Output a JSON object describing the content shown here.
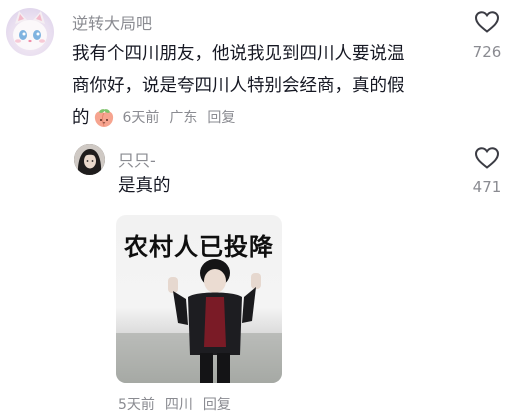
{
  "comment": {
    "username": "逆转大局吧",
    "lines": [
      "我有个四川朋友，他说我见到四川人要说温",
      "商你好，说是夸四川人特别会经商，真的假",
      "的"
    ],
    "emoji_icon": "peach-emoji-icon",
    "time": "6天前",
    "location": "广东",
    "reply_label": "回复",
    "like_count": "726"
  },
  "reply": {
    "username": "只只-",
    "text": "是真的",
    "sticker_text": "农村人已投降",
    "time": "5天前",
    "location": "四川",
    "reply_label": "回复",
    "like_count": "471"
  },
  "colors": {
    "text_primary": "#161823",
    "text_secondary": "#8a8b91"
  },
  "icons": [
    "cat-avatar-icon",
    "heart-icon",
    "peach-emoji-icon",
    "girl-avatar-icon"
  ]
}
